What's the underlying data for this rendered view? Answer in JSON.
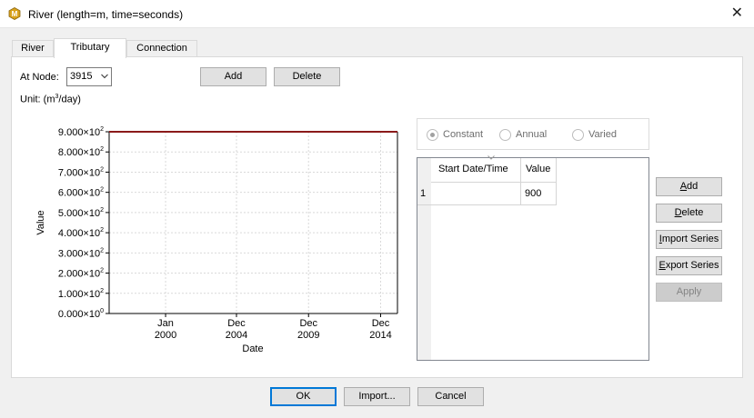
{
  "window": {
    "title": "River (length=m, time=seconds)",
    "close_glyph": "✕",
    "icon": "app-m-icon"
  },
  "tabs": [
    {
      "label": "River",
      "active": false
    },
    {
      "label": "Tributary",
      "active": true
    },
    {
      "label": "Connection",
      "active": false
    }
  ],
  "node": {
    "label": "At Node:",
    "value": "3915"
  },
  "top_buttons": {
    "add": "Add",
    "delete": "Delete"
  },
  "unit": {
    "prefix": "Unit: (m",
    "sup": "3",
    "suffix": "/day)"
  },
  "time_mode": {
    "options": [
      "Constant",
      "Annual",
      "Varied"
    ],
    "selected": "Constant"
  },
  "table": {
    "columns": [
      "Start Date/Time",
      "Value"
    ],
    "rows": [
      {
        "index": "1",
        "start": "",
        "value": "900"
      }
    ]
  },
  "side_buttons": {
    "add": {
      "pre": "",
      "ul": "A",
      "post": "dd"
    },
    "delete": {
      "pre": "",
      "ul": "D",
      "post": "elete"
    },
    "import_series": {
      "pre": "",
      "ul": "I",
      "post": "mport Series"
    },
    "export_series": {
      "pre": "",
      "ul": "E",
      "post": "xport Series"
    },
    "apply": "Apply"
  },
  "footer_buttons": {
    "ok": "OK",
    "import": "Import...",
    "cancel": "Cancel"
  },
  "colors": {
    "series_line": "#8b1a1a",
    "grid_line": "#d9d9d9",
    "default_button_border": "#0078d7"
  },
  "chart_data": {
    "type": "line",
    "xlabel": "Date",
    "ylabel": "Value",
    "ylim": [
      0,
      900
    ],
    "y_ticks": [
      {
        "mantissa": "0.000×10",
        "exp": "0",
        "value": 0
      },
      {
        "mantissa": "1.000×10",
        "exp": "2",
        "value": 100
      },
      {
        "mantissa": "2.000×10",
        "exp": "2",
        "value": 200
      },
      {
        "mantissa": "3.000×10",
        "exp": "2",
        "value": 300
      },
      {
        "mantissa": "4.000×10",
        "exp": "2",
        "value": 400
      },
      {
        "mantissa": "5.000×10",
        "exp": "2",
        "value": 500
      },
      {
        "mantissa": "6.000×10",
        "exp": "2",
        "value": 600
      },
      {
        "mantissa": "7.000×10",
        "exp": "2",
        "value": 700
      },
      {
        "mantissa": "8.000×10",
        "exp": "2",
        "value": 800
      },
      {
        "mantissa": "9.000×10",
        "exp": "2",
        "value": 900
      }
    ],
    "x_ticks": [
      {
        "line1": "Jan",
        "line2": "2000",
        "date": "2000-01-01"
      },
      {
        "line1": "Dec",
        "line2": "2004",
        "date": "2004-12-01"
      },
      {
        "line1": "Dec",
        "line2": "2009",
        "date": "2009-12-01"
      },
      {
        "line1": "Dec",
        "line2": "2014",
        "date": "2014-12-01"
      }
    ],
    "xlim": [
      "1996-02-01",
      "2016-02-01"
    ],
    "grid": true,
    "series": [
      {
        "points": [
          {
            "x": "1996-02-01",
            "y": 900
          },
          {
            "x": "2016-02-01",
            "y": 900
          }
        ]
      }
    ]
  }
}
